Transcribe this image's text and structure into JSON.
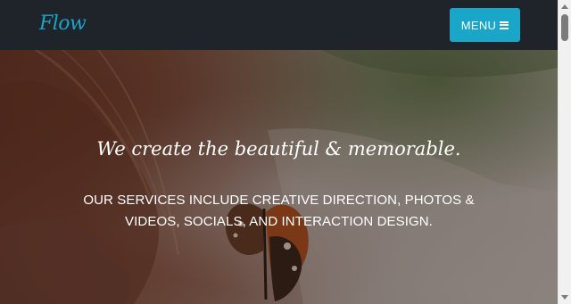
{
  "header": {
    "brand": "Flow",
    "menu_label": "MENU",
    "menu_icon": "hamburger-icon"
  },
  "hero": {
    "title": "We create the beautiful & memorable.",
    "subtitle": "OUR SERVICES INCLUDE CREATIVE DIRECTION, PHOTOS & VIDEOS, SOCIALS, AND INTERACTION DESIGN."
  },
  "colors": {
    "navbar_bg": "#1f232a",
    "accent": "#1aa6c9",
    "text_light": "#ffffff"
  }
}
